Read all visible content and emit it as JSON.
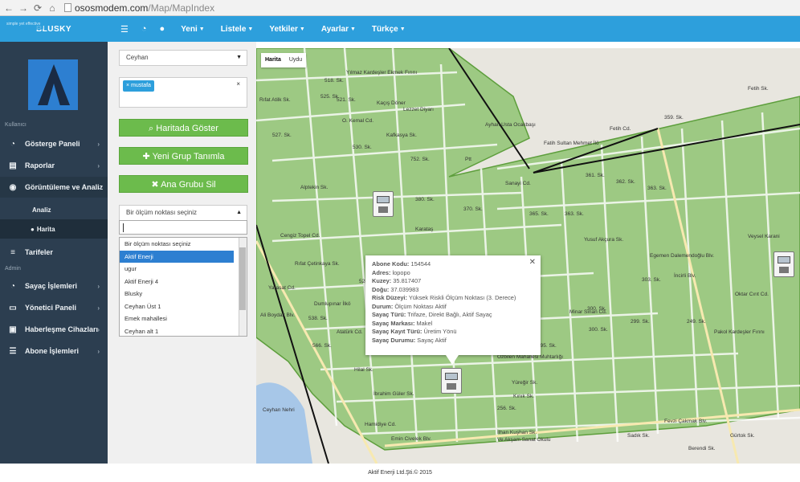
{
  "browser": {
    "url_host": "ososmodem.com",
    "url_path": "/Map/MapIndex"
  },
  "topnav": {
    "brand": "BLUSKY",
    "brand_tagline": "simple yet effective",
    "items": [
      "Yeni",
      "Listele",
      "Yetkiler",
      "Ayarlar",
      "Türkçe"
    ]
  },
  "sidebar": {
    "section_user": "Kullanıcı",
    "section_admin": "Admin",
    "items": {
      "dashboard": "Gösterge Paneli",
      "reports": "Raporlar",
      "viewing": "Görüntüleme ve Analiz",
      "analysis": "Analiz",
      "map": "Harita",
      "tariffs": "Tarifeler",
      "meter_ops": "Sayaç İşlemleri",
      "admin_panel": "Yönetici Paneli",
      "comm_devices": "Haberleşme Cihazları",
      "subscriber_ops": "Abone İşlemleri"
    }
  },
  "panel": {
    "region_select": "Ceyhan",
    "user_tag": "mustafa",
    "btn_show_map": "Haritada Göster",
    "btn_new_group": "Yeni Grup Tanımla",
    "btn_delete_group": "Ana Grubu Sil",
    "point_select": "Bir ölçüm noktası seçiniz",
    "options": [
      "Bir ölçüm noktası seçiniz",
      "Aktif Enerji",
      "ugur",
      "Aktif Enerji 4",
      "Blusky",
      "Ceyhan Üst 1",
      "Emek mahallesi",
      "Ceyhan alt 1"
    ]
  },
  "map": {
    "type_map": "Harita",
    "type_satellite": "Uydu",
    "info": {
      "rows": [
        {
          "label": "Abone Kodu:",
          "value": "154544"
        },
        {
          "label": "Adres:",
          "value": "lopopo"
        },
        {
          "label": "Kuzey:",
          "value": "35.817407"
        },
        {
          "label": "Doğu:",
          "value": "37.039983"
        },
        {
          "label": "Risk Düzeyi:",
          "value": "Yüksek Riskli Ölçüm Noktası (3. Derece)"
        },
        {
          "label": "Durum:",
          "value": "Ölçüm Noktası Aktif"
        },
        {
          "label": "Sayaç Türü:",
          "value": "Trifaze, Direkt Bağlı, Aktif Sayaç"
        },
        {
          "label": "Sayaç Markası:",
          "value": "Makel"
        },
        {
          "label": "Sayaç Kayıt Türü:",
          "value": "Üretim Yönü"
        },
        {
          "label": "Sayaç Durumu:",
          "value": "Sayaç Aktif"
        }
      ]
    },
    "streets": [
      "518. Sk.",
      "521. Sk.",
      "525. Sk.",
      "527. Sk.",
      "O. Kemal Cd.",
      "Kafkasya Sk.",
      "752. Sk.",
      "530. Sk.",
      "Lezzet Diyarı",
      "Kaçış Döner",
      "Ayhan Usta Ocakbaşı",
      "Fatih Sultan Mehmet İlö",
      "Fetih Cd.",
      "Fetih Sk.",
      "359. Sk.",
      "361. Sk.",
      "362. Sk.",
      "363. Sk.",
      "Sanayi Cd.",
      "Alptekin Sk.",
      "380. Sk.",
      "Cengiz Topel Cd.",
      "Rıfat Çetinkaya Sk.",
      "Yusuf Akçura Sk.",
      "Veysel Karani",
      "Karataş",
      "370. Sk.",
      "365. Sk.",
      "363. Sk.",
      "Dumlupınar İlkö",
      "538. Sk.",
      "Yarasat Cd.",
      "Atatürk Cd.",
      "566. Sk.",
      "Hilal Sk.",
      "İbrahim Güler Sk.",
      "Hamidiye Cd.",
      "Fevzi Çakmak Blv.",
      "Emin Civelek Blv.",
      "Ve Akşam Sanat Okulu",
      "Ceyhan Nehri",
      "Oktar Cırıt Cd.",
      "Pakol Kardeşler Fırını",
      "Gürtok Sk.",
      "Berendi Sk.",
      "Kınık Sk.",
      "Yüreğir Sk.",
      "Minar Sinan Cd.",
      "Egemen Dalemendoğlu Blv.",
      "İncirli Blv.",
      "300. Sk.",
      "303. Sk.",
      "300. Sk.",
      "299. Sk.",
      "295. Sk.",
      "256. Sk.",
      "249. Sk.",
      "Sadık Sk.",
      "Ptt",
      "Yılmaz Kardeşler Ekmek Fırını",
      "Ali Boydak Blv.",
      "Rıfat Atilk Sk.",
      "528. Sk.",
      "Özbilen Mahallesi Muhtarlığı",
      "İlhan Kuşhan Sk."
    ],
    "footer": "Aktif Enerji Ltd.Şti.© 2015"
  }
}
